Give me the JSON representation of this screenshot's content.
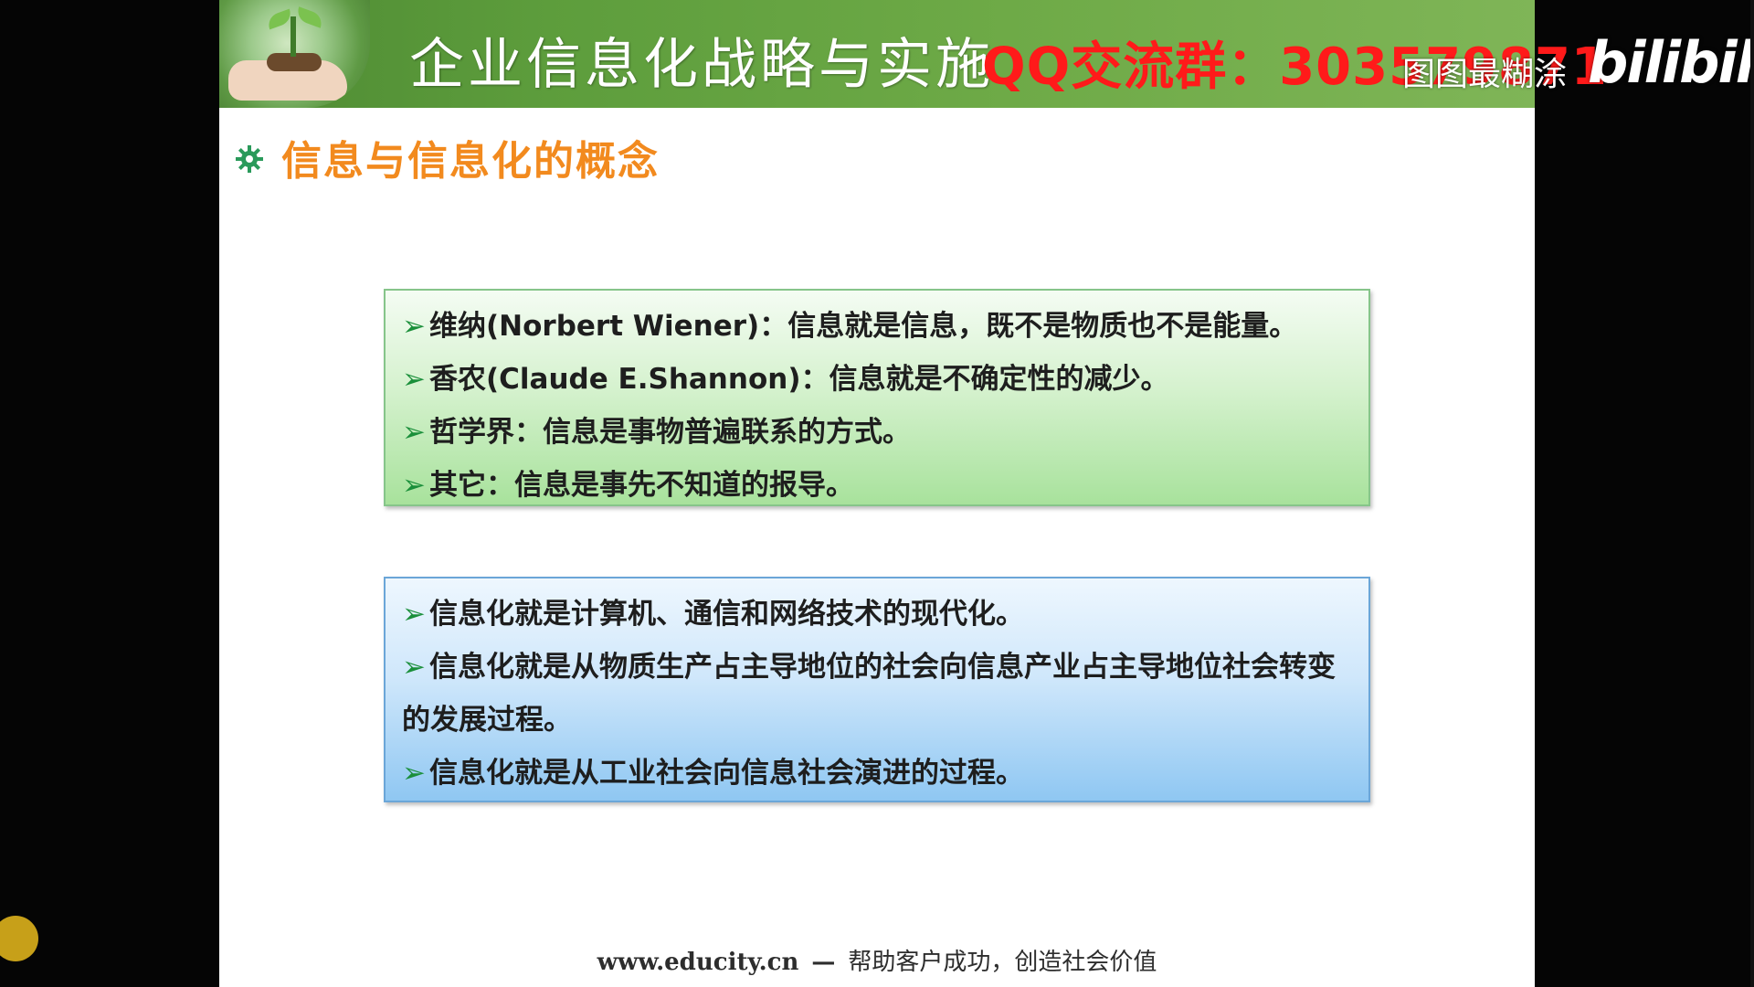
{
  "banner": {
    "title": "企业信息化战略与实施",
    "overlay_text": "QQ交流群：303579871",
    "uploader": "图图最糊涂",
    "platform_logo": "bilibili"
  },
  "section": {
    "icon": "gear-bullet-icon",
    "title": "信息与信息化的概念"
  },
  "information_box": {
    "bullet": "➢",
    "items": [
      "维纳(Norbert Wiener)：信息就是信息，既不是物质也不是能量。",
      "香农(Claude E.Shannon)：信息就是不确定性的减少。",
      "哲学界：信息是事物普遍联系的方式。",
      "其它：信息是事先不知道的报导。"
    ]
  },
  "informatization_box": {
    "bullet": "➢",
    "items": [
      "信息化就是计算机、通信和网络技术的现代化。",
      "信息化就是从物质生产占主导地位的社会向信息产业占主导地位社会转变的发展过程。",
      "信息化就是从工业社会向信息社会演进的过程。"
    ]
  },
  "footer": {
    "url": "www.educity.cn",
    "separator": "—",
    "slogan": "帮助客户成功，创造社会价值"
  },
  "colors": {
    "banner_green": "#5d9d3c",
    "heading_orange": "#f28a1e",
    "overlay_red": "#ff1a1a",
    "green_box": "#a8e29c",
    "blue_box": "#8fc7f2"
  }
}
